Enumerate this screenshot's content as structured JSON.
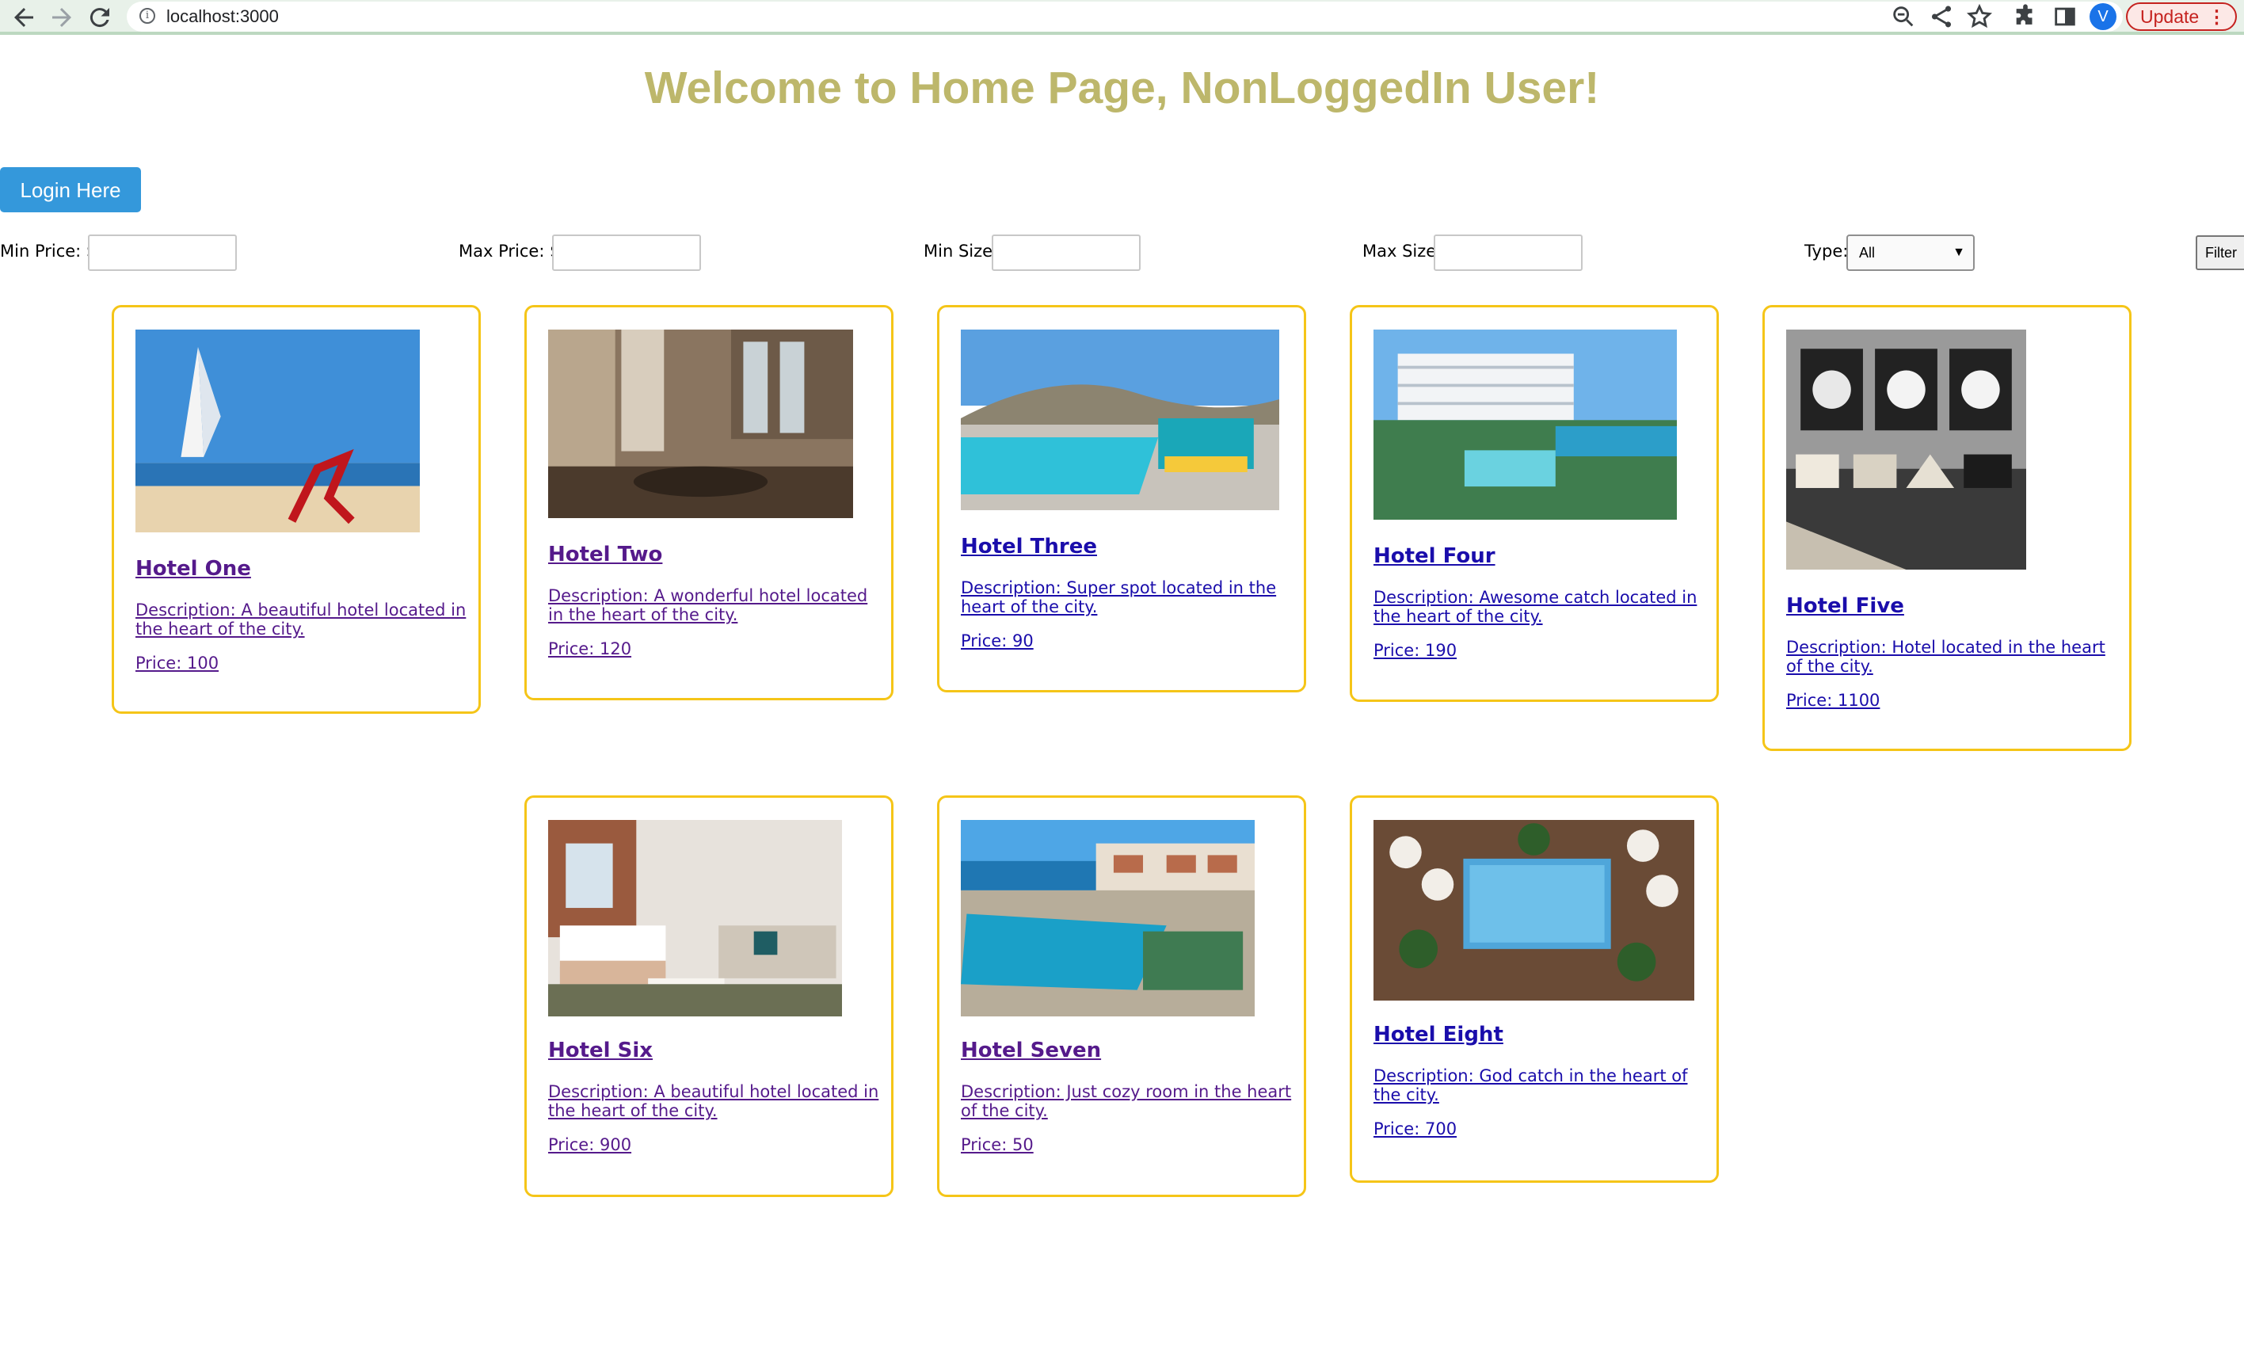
{
  "browser": {
    "url": "localhost:3000",
    "profile_initial": "V",
    "update_label": "Update"
  },
  "page": {
    "title": "Welcome to Home Page, NonLoggedIn User!",
    "login_label": "Login Here"
  },
  "filters": {
    "min_price_label": "Min Price: $",
    "max_price_label": "Max Price: $",
    "min_size_label": "Min Size:",
    "max_size_label": "Max Size:",
    "type_label": "Type:",
    "type_selected": "All",
    "filter_label": "Filter"
  },
  "hotels": [
    {
      "name": "Hotel One",
      "description": "Description: A beautiful hotel located in the heart of the city.",
      "price": "Price: 100"
    },
    {
      "name": "Hotel Two",
      "description": "Description: A wonderful hotel located in the heart of the city.",
      "price": "Price: 120"
    },
    {
      "name": "Hotel Three",
      "description": "Description: Super spot located in the heart of the city.",
      "price": "Price: 90"
    },
    {
      "name": "Hotel Four",
      "description": "Description: Awesome catch located in the heart of the city.",
      "price": "Price: 190"
    },
    {
      "name": "Hotel Five",
      "description": "Description: Hotel located in the heart of the city.",
      "price": "Price: 1100"
    },
    {
      "name": "Hotel Six",
      "description": "Description: A beautiful hotel located in the heart of the city.",
      "price": "Price: 900"
    },
    {
      "name": "Hotel Seven",
      "description": "Description: Just cozy room in the heart of the city.",
      "price": "Price: 50"
    },
    {
      "name": "Hotel Eight",
      "description": "Description: God catch in the heart of the city.",
      "price": "Price: 700"
    }
  ],
  "icons": {
    "back": "arrow-left-icon",
    "forward": "arrow-right-icon",
    "reload": "reload-icon",
    "info": "info-icon",
    "zoom": "zoom-icon",
    "share": "share-icon",
    "bookmark": "star-icon",
    "extensions": "puzzle-icon",
    "sidepanel": "sidepanel-icon"
  },
  "colors": {
    "title": "#bdb76b",
    "login_button": "#3498db",
    "card_border": "#f5c518",
    "link": "#1a0dab",
    "visited_link": "#551a8b"
  }
}
